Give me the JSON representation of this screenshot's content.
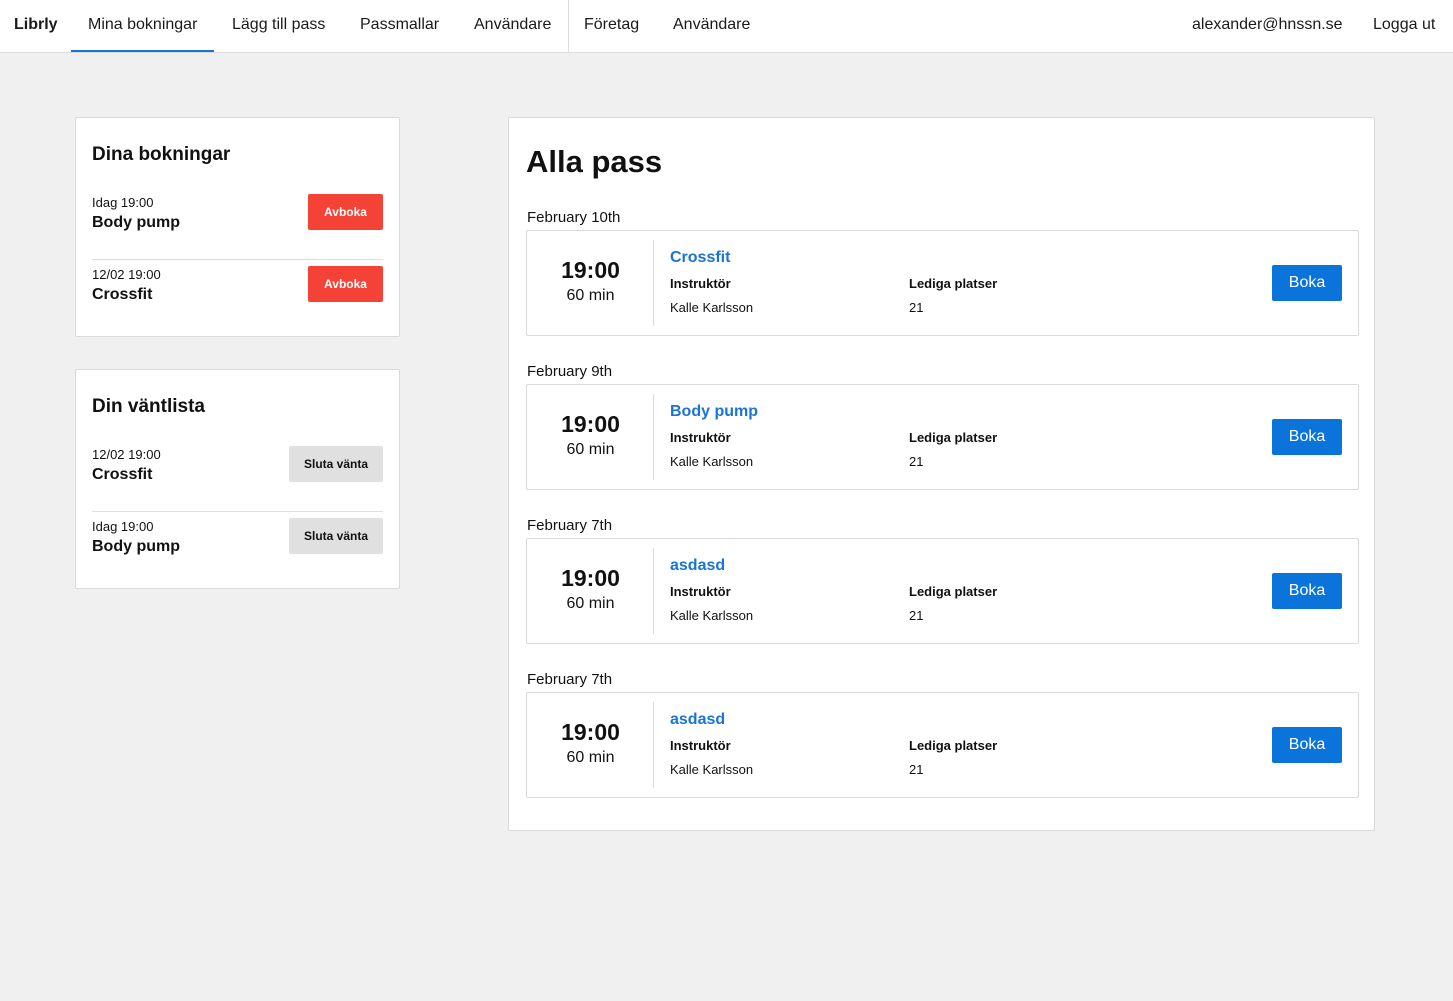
{
  "nav": {
    "brand": "Librly",
    "items": [
      "Mina bokningar",
      "Lägg till pass",
      "Passmallar",
      "Användare",
      "Företag",
      "Användare"
    ],
    "user": "alexander@hnssn.se",
    "logout": "Logga ut"
  },
  "bookings": {
    "title": "Dina bokningar",
    "items": [
      {
        "time": "Idag 19:00",
        "name": "Body pump",
        "action": "Avboka"
      },
      {
        "time": "12/02 19:00",
        "name": "Crossfit",
        "action": "Avboka"
      }
    ]
  },
  "waitlist": {
    "title": "Din väntlista",
    "items": [
      {
        "time": "12/02 19:00",
        "name": "Crossfit",
        "action": "Sluta vänta"
      },
      {
        "time": "Idag 19:00",
        "name": "Body pump",
        "action": "Sluta vänta"
      }
    ]
  },
  "main": {
    "title": "Alla pass",
    "sessions": [
      {
        "date": "February 10th",
        "time": "19:00",
        "duration": "60 min",
        "name": "Crossfit",
        "instructor_label": "Instruktör",
        "instructor": "Kalle Karlsson",
        "spots_label": "Lediga platser",
        "spots": "21",
        "action": "Boka"
      },
      {
        "date": "February 9th",
        "time": "19:00",
        "duration": "60 min",
        "name": "Body pump",
        "instructor_label": "Instruktör",
        "instructor": "Kalle Karlsson",
        "spots_label": "Lediga platser",
        "spots": "21",
        "action": "Boka"
      },
      {
        "date": "February 7th",
        "time": "19:00",
        "duration": "60 min",
        "name": "asdasd",
        "instructor_label": "Instruktör",
        "instructor": "Kalle Karlsson",
        "spots_label": "Lediga platser",
        "spots": "21",
        "action": "Boka"
      },
      {
        "date": "February 7th",
        "time": "19:00",
        "duration": "60 min",
        "name": "asdasd",
        "instructor_label": "Instruktör",
        "instructor": "Kalle Karlsson",
        "spots_label": "Lediga platser",
        "spots": "21",
        "action": "Boka"
      }
    ]
  },
  "colors": {
    "accent": "#1a73d9",
    "danger": "#f44336",
    "book": "#0a74da"
  }
}
